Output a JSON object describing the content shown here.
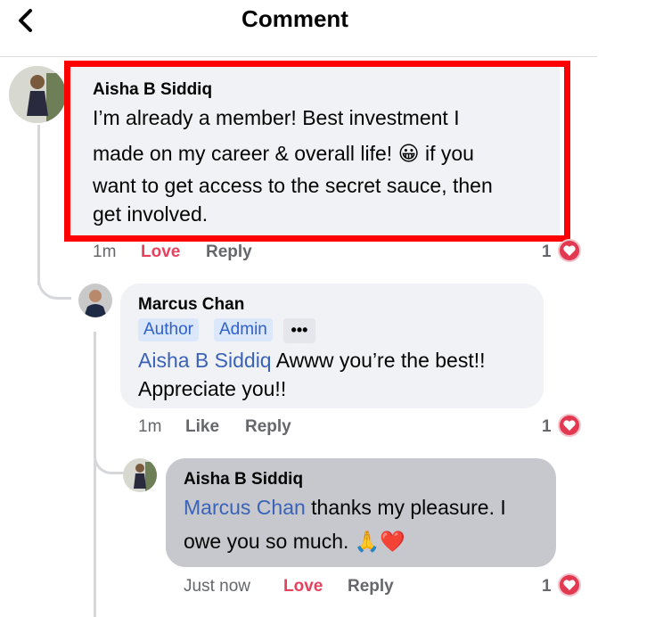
{
  "header": {
    "title": "Comment"
  },
  "comments": [
    {
      "author": "Aisha B Siddiq",
      "text_line1": "I’m already a member! Best investment I",
      "text_line2": "made on my career & overall life! 😀 if you",
      "text_line3": "want to get access to the secret sauce, then",
      "text_line4": "get involved.",
      "time": "1m",
      "action_react": "Love",
      "action_reply": "Reply",
      "reaction_count": "1"
    },
    {
      "author": "Marcus Chan",
      "badges": [
        "Author",
        "Admin"
      ],
      "more": "•••",
      "mention": "Aisha B Siddiq",
      "text_line1": " Awww you’re the best!!",
      "text_line2": "Appreciate you!!",
      "time": "1m",
      "action_react": "Like",
      "action_reply": "Reply",
      "reaction_count": "1"
    },
    {
      "author": "Aisha B Siddiq",
      "mention": "Marcus Chan",
      "text_line1": " thanks my pleasure. I",
      "text_line2": "owe you so much. 🙏❤️",
      "time": "Just now",
      "action_react": "Love",
      "action_reply": "Reply",
      "reaction_count": "1"
    }
  ],
  "colors": {
    "highlight": "#ff0000",
    "love": "#e8415e",
    "mention": "#3a63b8"
  }
}
